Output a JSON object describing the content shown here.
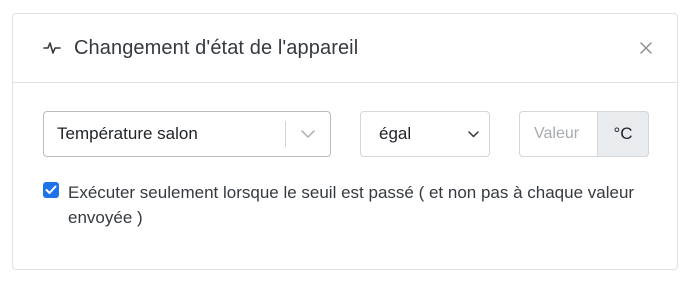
{
  "header": {
    "title": "Changement d'état de l'appareil",
    "icon": "activity-icon",
    "close_icon": "close-icon"
  },
  "condition": {
    "device": {
      "selected": "Température salon",
      "icon": "chevron-down-icon"
    },
    "operator": {
      "selected": "égal",
      "icon": "chevron-down-icon"
    },
    "value": {
      "placeholder": "Valeur",
      "unit": "°C"
    }
  },
  "option": {
    "checked": true,
    "label": "Exécuter seulement lorsque le seuil est passé ( et non pas à chaque valeur envoyée )"
  },
  "colors": {
    "accent": "#1f73e8",
    "border": "#dfe1e4",
    "addon_bg": "#e9ecef"
  }
}
